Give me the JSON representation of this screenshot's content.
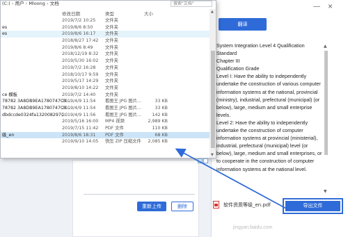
{
  "explorer": {
    "breadcrumb": [
      "(C:)",
      "用户",
      "Mloong",
      "文档"
    ],
    "search_placeholder": "搜索\"文档\"",
    "columns": {
      "name": "",
      "date": "修改日期",
      "type": "类型",
      "size": "大小"
    },
    "rows": [
      {
        "name": "",
        "date": "2019/7/2 10:25",
        "type": "文件夹",
        "size": ""
      },
      {
        "name": "es",
        "date": "2019/8/6 8:50",
        "type": "文件夹",
        "size": ""
      },
      {
        "name": "es",
        "date": "2019/8/6 16:17",
        "type": "文件夹",
        "size": ""
      },
      {
        "name": "",
        "date": "2018/8/27 17:42",
        "type": "文件夹",
        "size": ""
      },
      {
        "name": "",
        "date": "2019/8/6 8:49",
        "type": "文件夹",
        "size": ""
      },
      {
        "name": "",
        "date": "2018/12/19 8:32",
        "type": "文件夹",
        "size": ""
      },
      {
        "name": "",
        "date": "2019/5/30 16:02",
        "type": "文件夹",
        "size": ""
      },
      {
        "name": "",
        "date": "2019/7/2 16:28",
        "type": "文件夹",
        "size": ""
      },
      {
        "name": "",
        "date": "2018/10/17 9:59",
        "type": "文件夹",
        "size": ""
      },
      {
        "name": "",
        "date": "2019/5/17 14:29",
        "type": "文件夹",
        "size": ""
      },
      {
        "name": "",
        "date": "2019/8/10 14:22",
        "type": "文件夹",
        "size": ""
      },
      {
        "name": "ce 模板",
        "date": "2019/7/2 14:40",
        "type": "文件夹",
        "size": ""
      },
      {
        "name": "78782 3A8DB9EA1780747C9...",
        "date": "2019/4/9 11:54",
        "type": "看图王 JPG 图片...",
        "size": "33 KB"
      },
      {
        "name": "78782 3A8DB9EA1780747C9...",
        "date": "2019/4/9 11:54",
        "type": "看图王 JPG 图片...",
        "size": "33 KB"
      },
      {
        "name": "dbdccde0324fa132008297(...",
        "date": "2019/4/9 11:56",
        "type": "看图王 JPG 图片...",
        "size": "142 KB"
      },
      {
        "name": "",
        "date": "2019/5/16 16:00",
        "type": "MP4 视频",
        "size": "2,989 KB"
      },
      {
        "name": "",
        "date": "2019/7/15 11:42",
        "type": "PDF 文件",
        "size": "110 KB"
      },
      {
        "name": "级_en",
        "date": "2019/8/6 18:31",
        "type": "PDF 文件",
        "size": "68 KB"
      },
      {
        "name": "",
        "date": "2019/9/10 14:05",
        "type": "快压 ZIP 压缩文件",
        "size": "2,085 KB"
      }
    ],
    "selected_row": 17,
    "highlighted_row": 2
  },
  "translator": {
    "translate_button": "翻译",
    "text_lines": [
      "System Integration Level 4 Qualification",
      "Standard",
      "Chapter III",
      "Qualification Grade",
      "Level I: Have the ability to independently",
      "undertake the construction of various computer",
      "information systems at the national, provincial",
      "(ministry), industrial, prefectural (municipal) (or",
      "below), large, medium and small enterprise",
      "levels.",
      "Level 2: Have the ability to independently",
      "undertake the construction of computer",
      "information systems at provincial (ministerial),",
      "industrial, prefectural (municipal) level (or",
      "below), large, medium and small enterprises, or",
      "to cooperate in the construction of computer",
      "information systems at the national level."
    ],
    "file_name": "软件资质等级_en.pdf",
    "export_button": "导出文件"
  },
  "mid_panel": {
    "reupload_button": "重新上传",
    "delete_button": "删除"
  },
  "watermark": "jingyan.baidu.com",
  "colors": {
    "accent": "#2f6bd8",
    "arrow": "#2f6bd8",
    "selection": "#cce4f7"
  }
}
